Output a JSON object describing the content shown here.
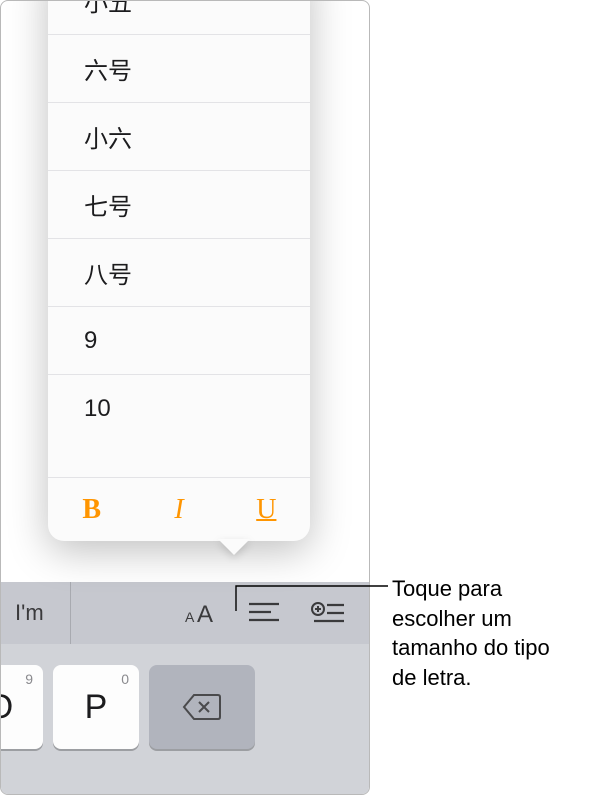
{
  "popover": {
    "sizes": [
      "小五",
      "六号",
      "小六",
      "七号",
      "八号",
      "9",
      "10"
    ],
    "styles": {
      "bold": "B",
      "italic": "I",
      "underline": "U"
    }
  },
  "suggestion_bar": {
    "word": "I'm"
  },
  "keyboard": {
    "keys": [
      {
        "main": "O",
        "alt": "9"
      },
      {
        "main": "P",
        "alt": "0"
      }
    ]
  },
  "callout": {
    "text": "Toque para escolher um tamanho do tipo de letra."
  }
}
